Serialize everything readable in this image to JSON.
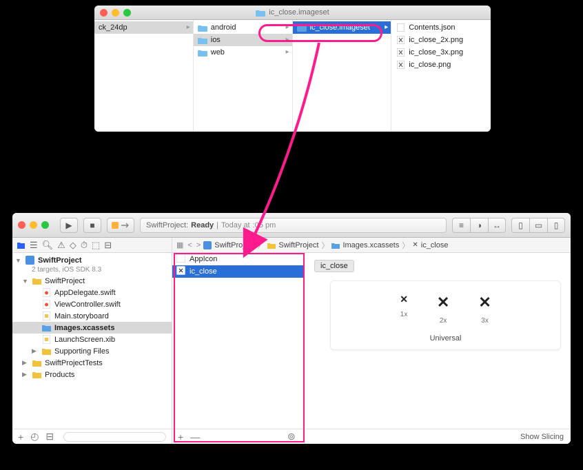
{
  "finder": {
    "title": "ic_close.imageset",
    "col1": {
      "item": "ck_24dp"
    },
    "col2": {
      "android": "android",
      "ios": "ios",
      "web": "web"
    },
    "col3": {
      "imageset": "ic_close.imageset"
    },
    "col4": {
      "contents": "Contents.json",
      "png2x": "ic_close_2x.png",
      "png3x": "ic_close_3x.png",
      "png1x": "ic_close.png"
    }
  },
  "xcode": {
    "activity_project": "SwiftProject:",
    "activity_status": "Ready",
    "activity_time_prefix": "Today at",
    "activity_time_suffix": ":05 pm",
    "breadcrumb": {
      "p1": "SwiftProject",
      "p2": "SwiftProject",
      "p3": "Images.xcassets",
      "p4": "ic_close"
    },
    "tree": {
      "project": "SwiftProject",
      "targets_meta": "2 targets, iOS SDK 8.3",
      "grp_swiftproject": "SwiftProject",
      "appdelegate": "AppDelegate.swift",
      "viewcontroller": "ViewController.swift",
      "mainstoryboard": "Main.storyboard",
      "imagesxcassets": "Images.xcassets",
      "launchscreen": "LaunchScreen.xib",
      "supportingfiles": "Supporting Files",
      "tests": "SwiftProjectTests",
      "products": "Products"
    },
    "outline": {
      "appicon": "AppIcon",
      "ic_close": "ic_close"
    },
    "detail": {
      "set_name": "ic_close",
      "l1x": "1x",
      "l2x": "2x",
      "l3x": "3x",
      "universal": "Universal",
      "show_slicing": "Show Slicing"
    },
    "footer": {
      "plus": "+",
      "minus": "—"
    }
  }
}
